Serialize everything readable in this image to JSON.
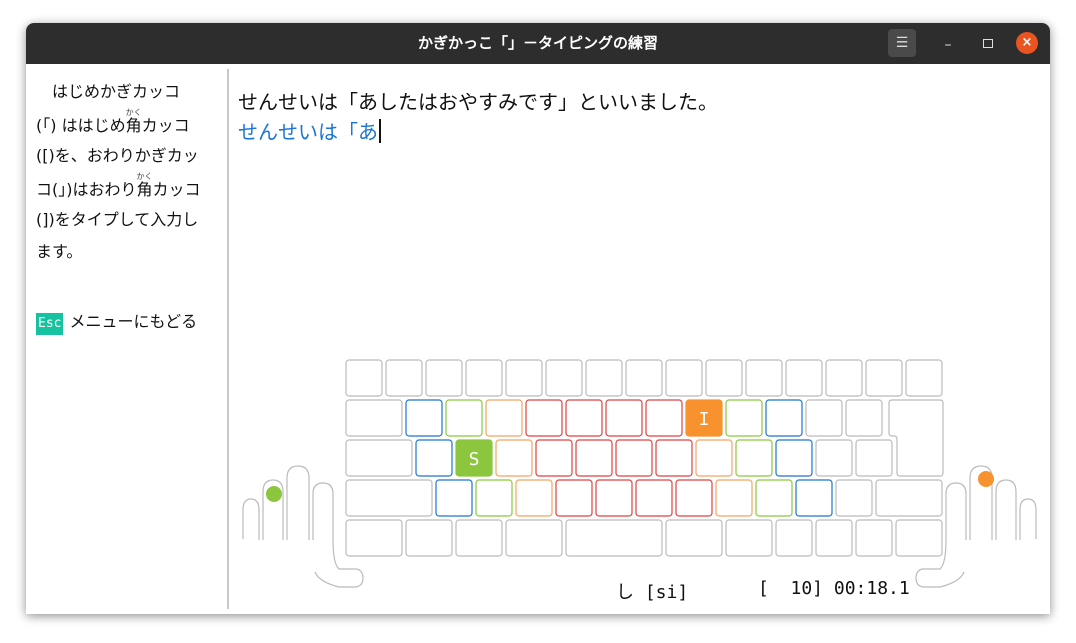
{
  "window": {
    "title": "かぎかっこ「」－タイピングの練習"
  },
  "titlebar": {
    "menu_icon": "hamburger-icon",
    "minimize_label": "–",
    "close_label": "×"
  },
  "sidebar": {
    "instruction_lines": [
      {
        "before": "　はじめかぎカッコ",
        "ruby_base": "",
        "ruby_text": "",
        "after": ""
      },
      {
        "before": "(「) ははじめ",
        "ruby_base": "角",
        "ruby_text": "かく",
        "after": "カッコ"
      },
      {
        "before": "([)を、おわりかぎカッ",
        "ruby_base": "",
        "ruby_text": "",
        "after": ""
      },
      {
        "before": "コ(」)はおわり",
        "ruby_base": "角",
        "ruby_text": "かく",
        "after": "カッコ"
      },
      {
        "before": "(])をタイプして入力し",
        "ruby_base": "",
        "ruby_text": "",
        "after": ""
      },
      {
        "before": "ます。",
        "ruby_base": "",
        "ruby_text": "",
        "after": ""
      }
    ],
    "esc_key": "Esc",
    "esc_label": "メニューにもどる"
  },
  "main": {
    "target_text": "せんせいは「あしたはおやすみです」といいました。",
    "typed_text": "せんせいは「あ",
    "current_char": "し [si]",
    "stats": "[  10] 00:18.1"
  },
  "keyboard": {
    "highlight_keys": [
      {
        "label": "I",
        "color": "#f7922e"
      },
      {
        "label": "S",
        "color": "#8cc63f"
      }
    ],
    "finger_colors": {
      "pinky": "#1c74d4",
      "ring": "#8cc63f",
      "middle": "#f4a460",
      "index": "#e04040"
    },
    "left_hand_dot_color": "#8cc63f",
    "right_hand_dot_color": "#f7922e"
  }
}
